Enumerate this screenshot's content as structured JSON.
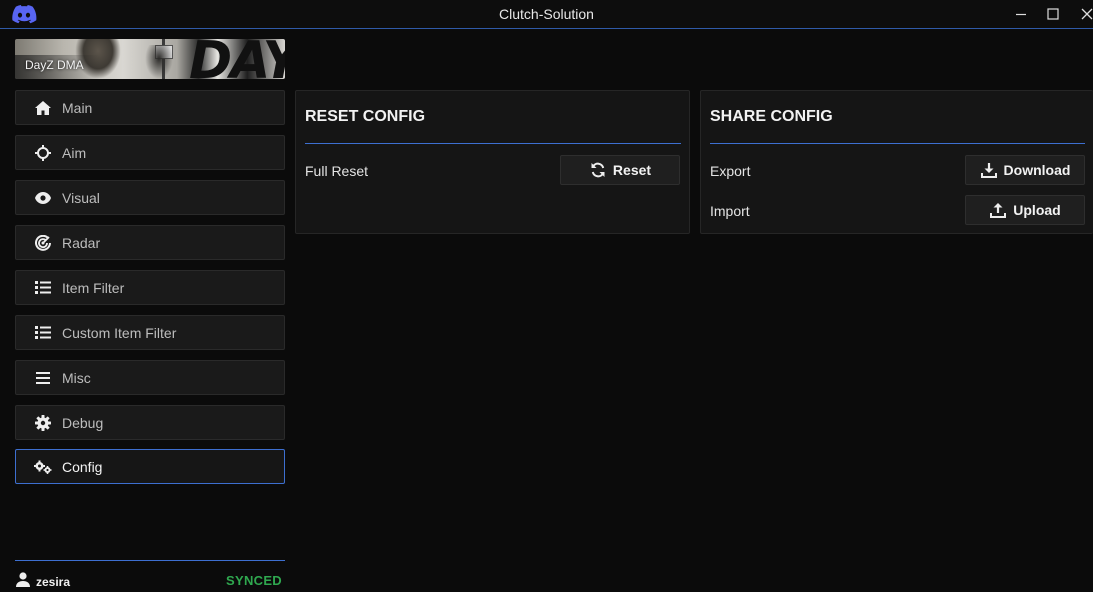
{
  "window": {
    "title": "Clutch-Solution",
    "icon": "discord-icon",
    "controls": [
      "minimize-icon",
      "maximize-icon",
      "close-icon"
    ]
  },
  "sidebar": {
    "banner_label": "DayZ DMA",
    "banner_art_text": "DAYZ",
    "items": [
      {
        "label": "Main",
        "icon": "home-icon"
      },
      {
        "label": "Aim",
        "icon": "crosshair-icon"
      },
      {
        "label": "Visual",
        "icon": "eye-icon"
      },
      {
        "label": "Radar",
        "icon": "radar-icon"
      },
      {
        "label": "Item Filter",
        "icon": "list-icon"
      },
      {
        "label": "Custom Item Filter",
        "icon": "list-icon"
      },
      {
        "label": "Misc",
        "icon": "menu-icon"
      },
      {
        "label": "Debug",
        "icon": "gear-icon"
      },
      {
        "label": "Config",
        "icon": "gears-icon",
        "active": true
      }
    ],
    "footer": {
      "username": "zesira",
      "status": "SYNCED",
      "status_color": "#2fa84f"
    }
  },
  "panels": {
    "reset": {
      "title": "RESET CONFIG",
      "rows": [
        {
          "label": "Full Reset",
          "button": "Reset",
          "icon": "refresh-icon"
        }
      ]
    },
    "share": {
      "title": "SHARE CONFIG",
      "rows": [
        {
          "label": "Export",
          "button": "Download",
          "icon": "download-icon"
        },
        {
          "label": "Import",
          "button": "Upload",
          "icon": "upload-icon"
        }
      ]
    }
  },
  "colors": {
    "accent": "#3d6fd0",
    "background": "#0b0b0b",
    "panel": "#151515"
  }
}
